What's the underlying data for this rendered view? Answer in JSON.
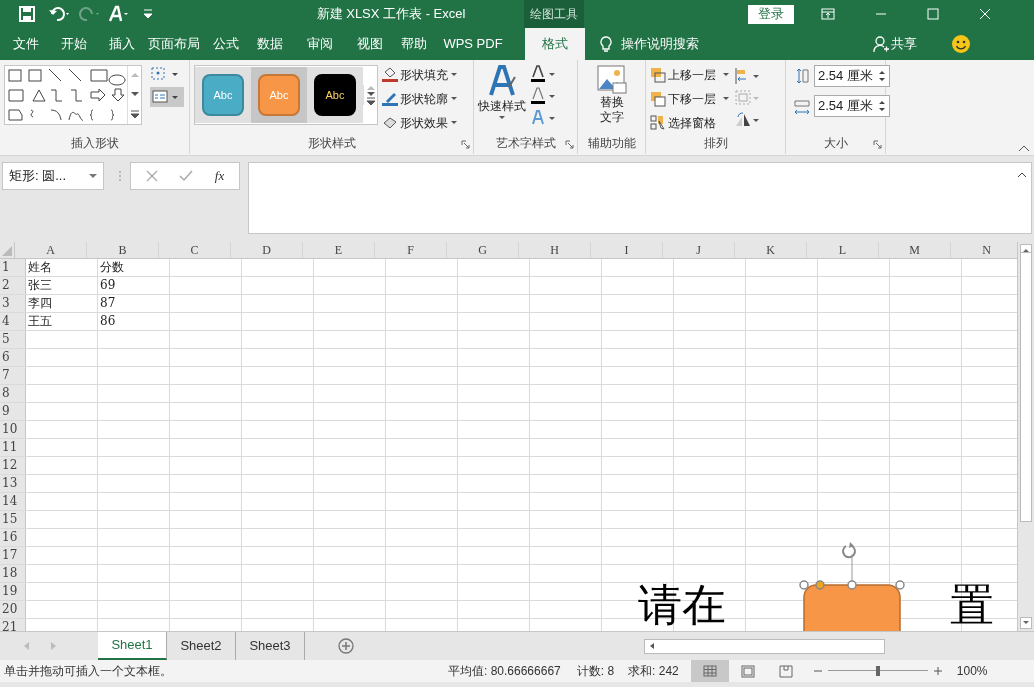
{
  "title_bar": {
    "title": "新建 XLSX 工作表  -  Excel",
    "context_label": "绘图工具",
    "login": "登录"
  },
  "menu_tabs": [
    {
      "label": "文件",
      "selected": false
    },
    {
      "label": "开始",
      "selected": false
    },
    {
      "label": "插入",
      "selected": false
    },
    {
      "label": "页面布局",
      "selected": false
    },
    {
      "label": "公式",
      "selected": false
    },
    {
      "label": "数据",
      "selected": false
    },
    {
      "label": "审阅",
      "selected": false
    },
    {
      "label": "视图",
      "selected": false
    },
    {
      "label": "帮助",
      "selected": false
    },
    {
      "label": "WPS PDF",
      "selected": false
    },
    {
      "label": "格式",
      "selected": true
    }
  ],
  "tell_me": "操作说明搜索",
  "share": "共享",
  "ribbon": {
    "insert_shapes": {
      "label": "插入形状"
    },
    "shape_styles": {
      "label": "形状样式",
      "styles": [
        {
          "text": "Abc",
          "color": "#4bacc6",
          "selected": false
        },
        {
          "text": "Abc",
          "color": "#f79646",
          "selected": true
        },
        {
          "text": "Abc",
          "color": "#000000",
          "selected": false
        }
      ],
      "commands": [
        "形状填充",
        "形状轮廓",
        "形状效果"
      ]
    },
    "wordart": {
      "quick_styles": "快速样式",
      "label": "艺术字样式"
    },
    "accessibility": {
      "alt_text": [
        "替换",
        "文字"
      ],
      "label": "辅助功能"
    },
    "arrange": {
      "commands": [
        "上移一层",
        "下移一层",
        "选择窗格"
      ],
      "label": "排列"
    },
    "size": {
      "height": "2.54 厘米",
      "width": "2.54 厘米",
      "label": "大小"
    }
  },
  "formula_bar": {
    "name_box": "矩形: 圆...",
    "fx": "fx"
  },
  "columns": [
    "A",
    "B",
    "C",
    "D",
    "E",
    "F",
    "G",
    "H",
    "I",
    "J",
    "K",
    "L",
    "M",
    "N"
  ],
  "rows": [
    {
      "n": "1",
      "cells": [
        "姓名",
        "分数"
      ]
    },
    {
      "n": "2",
      "cells": [
        "张三",
        "69"
      ]
    },
    {
      "n": "3",
      "cells": [
        "李四",
        "87"
      ]
    },
    {
      "n": "4",
      "cells": [
        "王五",
        "86"
      ]
    },
    {
      "n": "5",
      "cells": []
    },
    {
      "n": "6",
      "cells": []
    },
    {
      "n": "7",
      "cells": []
    },
    {
      "n": "8",
      "cells": []
    },
    {
      "n": "9",
      "cells": []
    },
    {
      "n": "10",
      "cells": []
    },
    {
      "n": "11",
      "cells": []
    },
    {
      "n": "12",
      "cells": []
    },
    {
      "n": "13",
      "cells": []
    },
    {
      "n": "14",
      "cells": []
    },
    {
      "n": "15",
      "cells": []
    },
    {
      "n": "16",
      "cells": []
    },
    {
      "n": "17",
      "cells": []
    },
    {
      "n": "18",
      "cells": []
    },
    {
      "n": "19",
      "cells": []
    },
    {
      "n": "20",
      "cells": []
    },
    {
      "n": "21",
      "cells": []
    }
  ],
  "canvas_text": [
    "请在",
    "置"
  ],
  "sheet_tabs": [
    {
      "label": "Sheet1",
      "selected": true
    },
    {
      "label": "Sheet2",
      "selected": false
    },
    {
      "label": "Sheet3",
      "selected": false
    }
  ],
  "status_bar": {
    "message": "单击并拖动可插入一个文本框。",
    "average": "平均值: 80.66666667",
    "count": "计数: 8",
    "sum": "求和: 242",
    "views": [
      {
        "kind": "normal",
        "selected": true
      },
      {
        "kind": "layout",
        "selected": false
      },
      {
        "kind": "pagebreak",
        "selected": false
      }
    ],
    "zoom": {
      "level": 0.5,
      "reading": "100%"
    }
  }
}
